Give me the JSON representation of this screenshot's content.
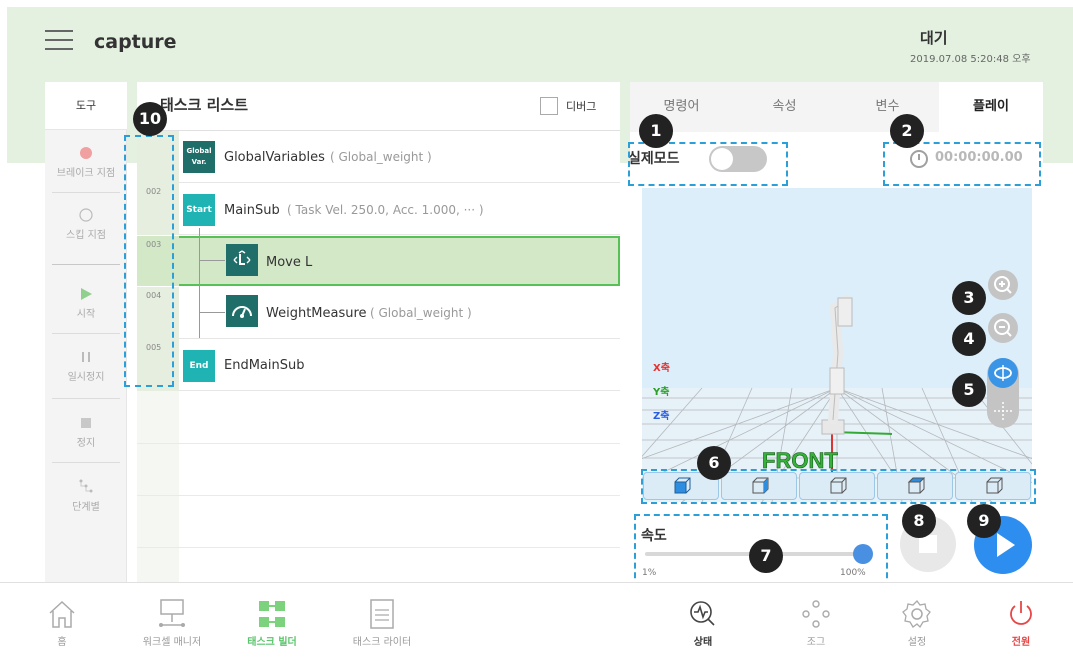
{
  "header": {
    "title": "capture",
    "status": "대기",
    "datetime": "2019.07.08 5:20:48 오후"
  },
  "toolbar": {
    "title": "도구",
    "items": [
      {
        "label": "브레이크 지점",
        "icon": "breakpoint-icon"
      },
      {
        "label": "스킵 지점",
        "icon": "skip-icon"
      },
      {
        "label": "시작",
        "icon": "play-icon"
      },
      {
        "label": "일시정지",
        "icon": "pause-icon"
      },
      {
        "label": "정지",
        "icon": "stop-icon"
      },
      {
        "label": "단계별",
        "icon": "step-icon"
      }
    ]
  },
  "task_list": {
    "title": "태스크 리스트",
    "debug_label": "디버그",
    "rows": [
      {
        "num": "",
        "badge": "Global Var.",
        "badge_color": "#1f6e6a",
        "name": "GlobalVariables",
        "sub": "( Global_weight )"
      },
      {
        "num": "002",
        "badge": "Start",
        "badge_color": "#1fb3b3",
        "name": "MainSub",
        "sub": "( Task Vel. 250.0, Acc. 1.000, ··· )"
      },
      {
        "num": "003",
        "badge": "",
        "badge_color": "#1f6e6a",
        "name": "Move L",
        "sub": ""
      },
      {
        "num": "004",
        "badge": "",
        "badge_color": "#1f6e6a",
        "name": "WeightMeasure",
        "sub": "( Global_weight )"
      },
      {
        "num": "005",
        "badge": "End",
        "badge_color": "#1fb3b3",
        "name": "EndMainSub",
        "sub": ""
      }
    ]
  },
  "right_panel": {
    "tabs": [
      "명령어",
      "속성",
      "변수",
      "플레이"
    ],
    "active_tab": "플레이",
    "real_mode_label": "실제모드",
    "timer": "00:00:00.00",
    "axes": {
      "x": "X축",
      "y": "Y축",
      "z": "Z축"
    },
    "front_label": "FRONT",
    "speed_label": "속도",
    "speed_min": "1%",
    "speed_max": "100%",
    "speed_value": 100
  },
  "callouts": [
    "1",
    "2",
    "3",
    "4",
    "5",
    "6",
    "7",
    "8",
    "9",
    "10"
  ],
  "bottom_nav": {
    "left": [
      {
        "label": "홈",
        "icon": "home-icon"
      },
      {
        "label": "워크셀 매니저",
        "icon": "workcell-icon"
      },
      {
        "label": "태스크 빌더",
        "icon": "task-builder-icon"
      },
      {
        "label": "태스크 라이터",
        "icon": "task-writer-icon"
      }
    ],
    "right": [
      {
        "label": "상태",
        "icon": "status-icon"
      },
      {
        "label": "조그",
        "icon": "jog-icon"
      },
      {
        "label": "설정",
        "icon": "settings-icon"
      },
      {
        "label": "전원",
        "icon": "power-icon"
      }
    ]
  },
  "colors": {
    "accent": "#2a9fd8",
    "header_bg": "#e4f1e0",
    "selected_row": "#d3e8c7",
    "power": "#e84545"
  }
}
